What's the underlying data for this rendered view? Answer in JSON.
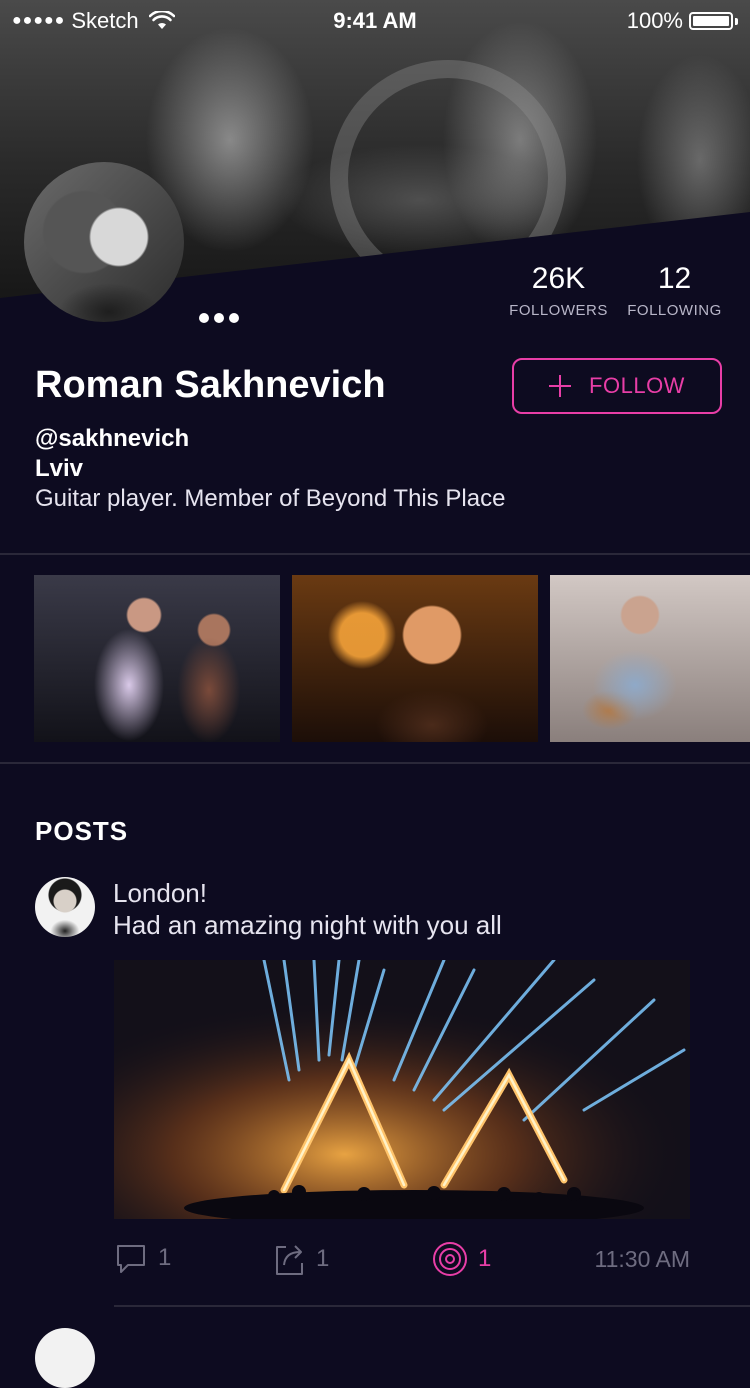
{
  "status_bar": {
    "carrier": "Sketch",
    "time": "9:41 AM",
    "battery": "100%",
    "battery_level": 1.0
  },
  "profile": {
    "name": "Roman Sakhnevich",
    "handle": "@sakhnevich",
    "location": "Lviv",
    "bio": "Guitar player. Member of Beyond This Place",
    "follow_label": "FOLLOW",
    "stats": {
      "followers_value": "26K",
      "followers_label": "FOLLOWERS",
      "following_value": "12",
      "following_label": "FOLLOWING"
    }
  },
  "gallery": {
    "photos": [
      "photo-1",
      "photo-2",
      "photo-3"
    ]
  },
  "posts": {
    "heading": "POSTS",
    "items": [
      {
        "text_line_1": "London!",
        "text_line_2": "Had an amazing night with you all",
        "comments": "1",
        "shares": "1",
        "likes": "1",
        "time": "11:30 AM"
      }
    ]
  },
  "colors": {
    "background": "#0d0b20",
    "accent": "#e83ea7",
    "muted": "#6e6c80",
    "divider": "#2a2839"
  }
}
